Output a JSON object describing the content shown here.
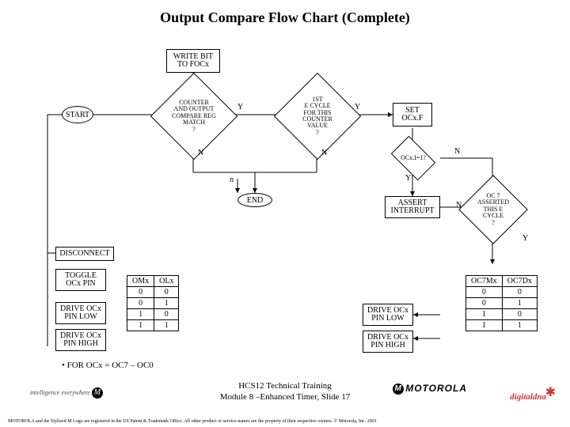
{
  "title": "Output Compare Flow Chart (Complete)",
  "nodes": {
    "write_bit": "WRITE BIT\nTO FOCx",
    "start": "START",
    "counter_match": "COUNTER\nAND OUTPUT\nCOMPARE REG\nMATCH\n?",
    "first_cycle": "1ST\nE CYCLE\nFOR THIS\nCOUNTER\nVALUE\n?",
    "set_ocxf": "SET\nOCx.F",
    "ocxi1": "OCx.I=1?",
    "end": "END",
    "assert_int": "ASSERT\nINTERRUPT",
    "oc7_asserted": "OC 7\nASSERTED\nTHIS E\nCYCLE\n?",
    "disconnect": "DISCONNECT",
    "toggle_pin": "TOGGLE\nOCx PIN",
    "drive_low_l": "DRIVE OCx\nPIN LOW",
    "drive_high_l": "DRIVE OCx\nPIN HIGH",
    "drive_low_r": "DRIVE OCx\nPIN LOW",
    "drive_high_r": "DRIVE OCx\nPIN HIGH"
  },
  "edges": {
    "y": "Y",
    "n": "N",
    "n_lower": "n"
  },
  "table_left": {
    "headers": [
      "OMx",
      "OLx"
    ],
    "rows": [
      [
        "0",
        "0"
      ],
      [
        "0",
        "1"
      ],
      [
        "1",
        "0"
      ],
      [
        "1",
        "1"
      ]
    ]
  },
  "table_right": {
    "headers": [
      "OC7Mx",
      "OC7Dx"
    ],
    "rows": [
      [
        "0",
        "0"
      ],
      [
        "0",
        "1"
      ],
      [
        "1",
        "0"
      ],
      [
        "1",
        "1"
      ]
    ]
  },
  "bullet": "• FOR OCx = OC7 – OC0",
  "footer": {
    "training_line1": "HCS12 Technical Training",
    "training_line2": "Module 8 –Enhanced Timer, Slide 17",
    "motorola": "MOTOROLA",
    "digitaldna": "digitaldna",
    "ie": "intelligence everywhere",
    "legal": "MOTOROLA and the Stylized M Logo are registered in the US Patent & Trademark Office. All other product or service names are the property of their respective owners. © Motorola, Inc. 2001"
  }
}
